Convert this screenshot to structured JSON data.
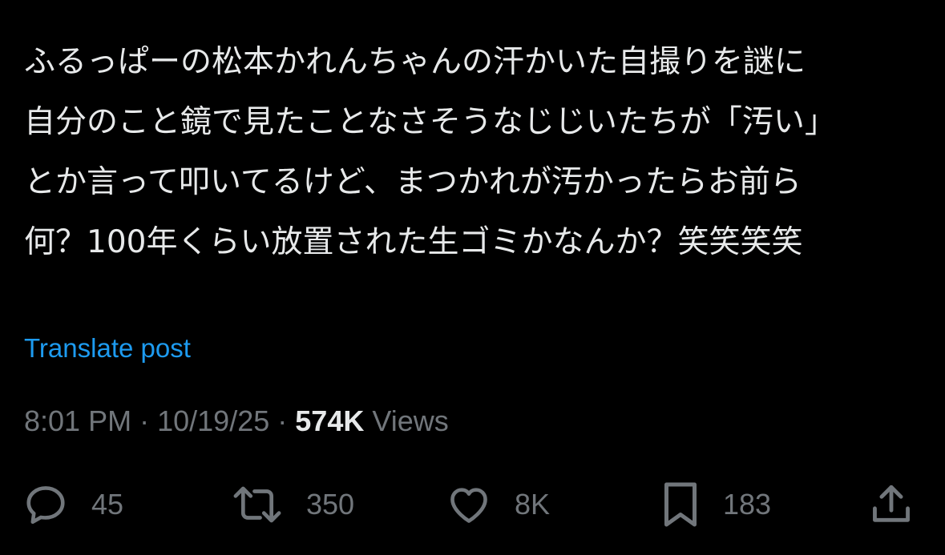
{
  "post": {
    "text_lines": [
      "ふるっぱーの松本かれんちゃんの汗かいた自撮りを謎に",
      "自分のこと鏡で見たことなさそうなじじいたちが「汚い」",
      "とか言って叩いてるけど、まつかれが汚かったらお前ら",
      "何？100年くらい放置された生ゴミかなんか？笑笑笑笑"
    ],
    "translate_label": "Translate post",
    "time": "8:01 PM",
    "separator": "·",
    "date": "10/19/25",
    "views_count": "574K",
    "views_label": "Views"
  },
  "actions": {
    "reply": {
      "icon": "reply-icon",
      "count": "45"
    },
    "repost": {
      "icon": "repost-icon",
      "count": "350"
    },
    "like": {
      "icon": "heart-icon",
      "count": "8K"
    },
    "bookmark": {
      "icon": "bookmark-icon",
      "count": "183"
    },
    "share": {
      "icon": "share-icon"
    }
  },
  "colors": {
    "background": "#000000",
    "text": "#e7e9ea",
    "secondary": "#71767b",
    "link": "#1d9bf0"
  }
}
